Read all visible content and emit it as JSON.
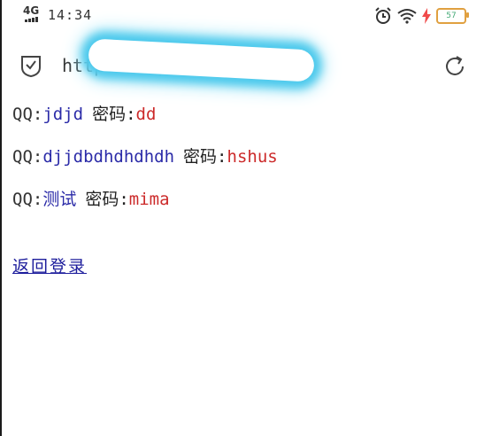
{
  "status": {
    "network": "4G",
    "time": "14:34",
    "battery": "57"
  },
  "address_bar": {
    "url": "https://                              php"
  },
  "records": [
    {
      "qq_label": "QQ:",
      "qq": "jdjd",
      "pw_label": "密码:",
      "pw": "dd"
    },
    {
      "qq_label": "QQ:",
      "qq": "djjdbdhdhdhdh",
      "pw_label": "密码:",
      "pw": "hshus"
    },
    {
      "qq_label": "QQ:",
      "qq": "测试",
      "pw_label": "密码:",
      "pw": "mima"
    }
  ],
  "back_link": "返回登录",
  "colors": {
    "qq_value": "#2b2ba8",
    "password_value": "#cc2a2a",
    "link": "#1d1d9c",
    "blur_glow": "#4cc9ec"
  }
}
